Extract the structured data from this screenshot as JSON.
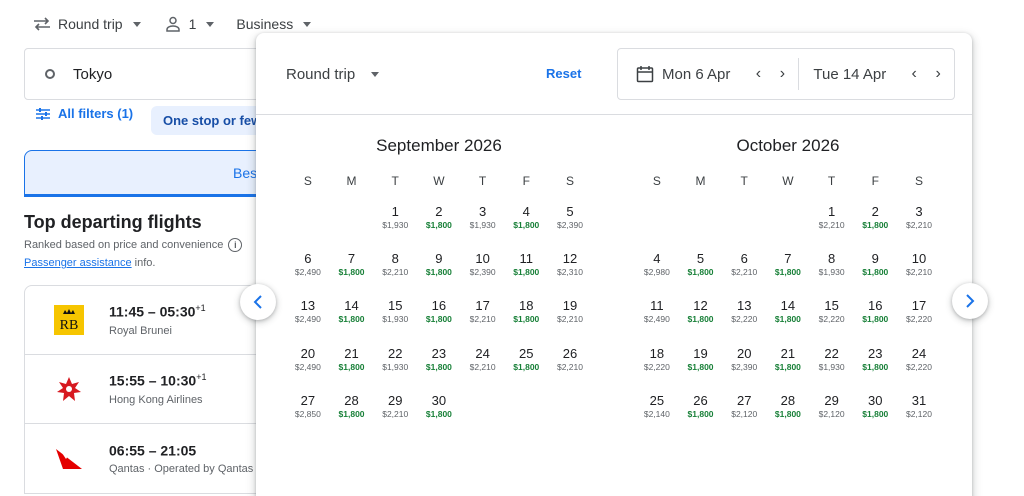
{
  "topbar": {
    "trip_type": "Round trip",
    "passengers": "1",
    "cabin": "Business"
  },
  "search": {
    "origin": "Tokyo"
  },
  "filters": {
    "all_filters": "All filters (1)",
    "stops_chip": "One stop or fewer"
  },
  "tabs": {
    "best": "Best"
  },
  "results": {
    "title": "Top departing flights",
    "subtitle": "Ranked based on price and convenience",
    "link_text": "Passenger assistance",
    "link_suffix": " info."
  },
  "flights": [
    {
      "time": "11:45 – 05:30",
      "suffix": "+1",
      "airline": "Royal Brunei",
      "logo": "royal-brunei-logo"
    },
    {
      "time": "15:55 – 10:30",
      "suffix": "+1",
      "airline": "Hong Kong Airlines",
      "logo": "hong-kong-airlines-logo"
    },
    {
      "time": "06:55 – 21:05",
      "suffix": "",
      "airline": "Qantas · Operated by Qantas",
      "logo": "qantas-logo"
    }
  ],
  "popup": {
    "trip_type": "Round trip",
    "reset": "Reset",
    "depart": "Mon 6 Apr",
    "return": "Tue 14 Apr"
  },
  "weekdays": [
    "S",
    "M",
    "T",
    "W",
    "T",
    "F",
    "S"
  ],
  "colors": {
    "accent": "#1a73e8",
    "low_price": "#188038",
    "chip_bg": "#e8f0fe"
  },
  "months": [
    {
      "title": "September 2026",
      "offset": 2,
      "days": [
        {
          "d": "1",
          "p": "$1,930",
          "low": false
        },
        {
          "d": "2",
          "p": "$1,800",
          "low": true
        },
        {
          "d": "3",
          "p": "$1,930",
          "low": false
        },
        {
          "d": "4",
          "p": "$1,800",
          "low": true
        },
        {
          "d": "5",
          "p": "$2,390",
          "low": false
        },
        {
          "d": "6",
          "p": "$2,490",
          "low": false
        },
        {
          "d": "7",
          "p": "$1,800",
          "low": true
        },
        {
          "d": "8",
          "p": "$2,210",
          "low": false
        },
        {
          "d": "9",
          "p": "$1,800",
          "low": true
        },
        {
          "d": "10",
          "p": "$2,390",
          "low": false
        },
        {
          "d": "11",
          "p": "$1,800",
          "low": true
        },
        {
          "d": "12",
          "p": "$2,310",
          "low": false
        },
        {
          "d": "13",
          "p": "$2,490",
          "low": false
        },
        {
          "d": "14",
          "p": "$1,800",
          "low": true
        },
        {
          "d": "15",
          "p": "$1,930",
          "low": false
        },
        {
          "d": "16",
          "p": "$1,800",
          "low": true
        },
        {
          "d": "17",
          "p": "$2,210",
          "low": false
        },
        {
          "d": "18",
          "p": "$1,800",
          "low": true
        },
        {
          "d": "19",
          "p": "$2,210",
          "low": false
        },
        {
          "d": "20",
          "p": "$2,490",
          "low": false
        },
        {
          "d": "21",
          "p": "$1,800",
          "low": true
        },
        {
          "d": "22",
          "p": "$1,930",
          "low": false
        },
        {
          "d": "23",
          "p": "$1,800",
          "low": true
        },
        {
          "d": "24",
          "p": "$2,210",
          "low": false
        },
        {
          "d": "25",
          "p": "$1,800",
          "low": true
        },
        {
          "d": "26",
          "p": "$2,210",
          "low": false
        },
        {
          "d": "27",
          "p": "$2,850",
          "low": false
        },
        {
          "d": "28",
          "p": "$1,800",
          "low": true
        },
        {
          "d": "29",
          "p": "$2,210",
          "low": false
        },
        {
          "d": "30",
          "p": "$1,800",
          "low": true
        }
      ]
    },
    {
      "title": "October 2026",
      "offset": 4,
      "days": [
        {
          "d": "1",
          "p": "$2,210",
          "low": false
        },
        {
          "d": "2",
          "p": "$1,800",
          "low": true
        },
        {
          "d": "3",
          "p": "$2,210",
          "low": false
        },
        {
          "d": "4",
          "p": "$2,980",
          "low": false
        },
        {
          "d": "5",
          "p": "$1,800",
          "low": true
        },
        {
          "d": "6",
          "p": "$2,210",
          "low": false
        },
        {
          "d": "7",
          "p": "$1,800",
          "low": true
        },
        {
          "d": "8",
          "p": "$1,930",
          "low": false
        },
        {
          "d": "9",
          "p": "$1,800",
          "low": true
        },
        {
          "d": "10",
          "p": "$2,210",
          "low": false
        },
        {
          "d": "11",
          "p": "$2,490",
          "low": false
        },
        {
          "d": "12",
          "p": "$1,800",
          "low": true
        },
        {
          "d": "13",
          "p": "$2,220",
          "low": false
        },
        {
          "d": "14",
          "p": "$1,800",
          "low": true
        },
        {
          "d": "15",
          "p": "$2,220",
          "low": false
        },
        {
          "d": "16",
          "p": "$1,800",
          "low": true
        },
        {
          "d": "17",
          "p": "$2,220",
          "low": false
        },
        {
          "d": "18",
          "p": "$2,220",
          "low": false
        },
        {
          "d": "19",
          "p": "$1,800",
          "low": true
        },
        {
          "d": "20",
          "p": "$2,390",
          "low": false
        },
        {
          "d": "21",
          "p": "$1,800",
          "low": true
        },
        {
          "d": "22",
          "p": "$1,930",
          "low": false
        },
        {
          "d": "23",
          "p": "$1,800",
          "low": true
        },
        {
          "d": "24",
          "p": "$2,220",
          "low": false
        },
        {
          "d": "25",
          "p": "$2,140",
          "low": false
        },
        {
          "d": "26",
          "p": "$1,800",
          "low": true
        },
        {
          "d": "27",
          "p": "$2,120",
          "low": false
        },
        {
          "d": "28",
          "p": "$1,800",
          "low": true
        },
        {
          "d": "29",
          "p": "$2,120",
          "low": false
        },
        {
          "d": "30",
          "p": "$1,800",
          "low": true
        },
        {
          "d": "31",
          "p": "$2,120",
          "low": false
        }
      ]
    }
  ]
}
